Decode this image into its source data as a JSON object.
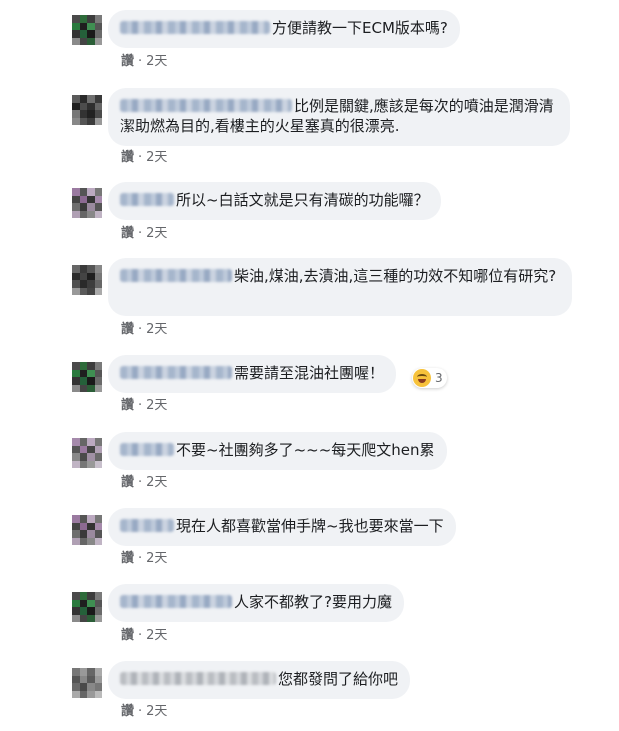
{
  "comments": [
    {
      "text": "方便請教一下ECM版本嗎?",
      "like_label": "讚",
      "time": "2天"
    },
    {
      "text": "比例是關鍵,應該是每次的噴油是潤滑清潔助燃為目的,看樓主的火星塞真的很漂亮.",
      "like_label": "讚",
      "time": "2天"
    },
    {
      "text": "所以~白話文就是只有清碳的功能囉？",
      "like_label": "讚",
      "time": "2天"
    },
    {
      "text": "柴油,煤油,去漬油,這三種的功效不知哪位有研究?",
      "like_label": "讚",
      "time": "2天"
    },
    {
      "text": "需要請至混油社團喔！",
      "like_label": "讚",
      "time": "2天",
      "reaction_count": "3"
    },
    {
      "text": "不要~社團夠多了~~~每天爬文hen累",
      "like_label": "讚",
      "time": "2天"
    },
    {
      "text": "現在人都喜歡當伸手牌~我也要來當一下",
      "like_label": "讚",
      "time": "2天"
    },
    {
      "text": "人家不都教了?要用力魔",
      "like_label": "讚",
      "time": "2天"
    },
    {
      "text": "您都發問了給你吧",
      "like_label": "讚",
      "time": "2天"
    }
  ],
  "separator": "·"
}
